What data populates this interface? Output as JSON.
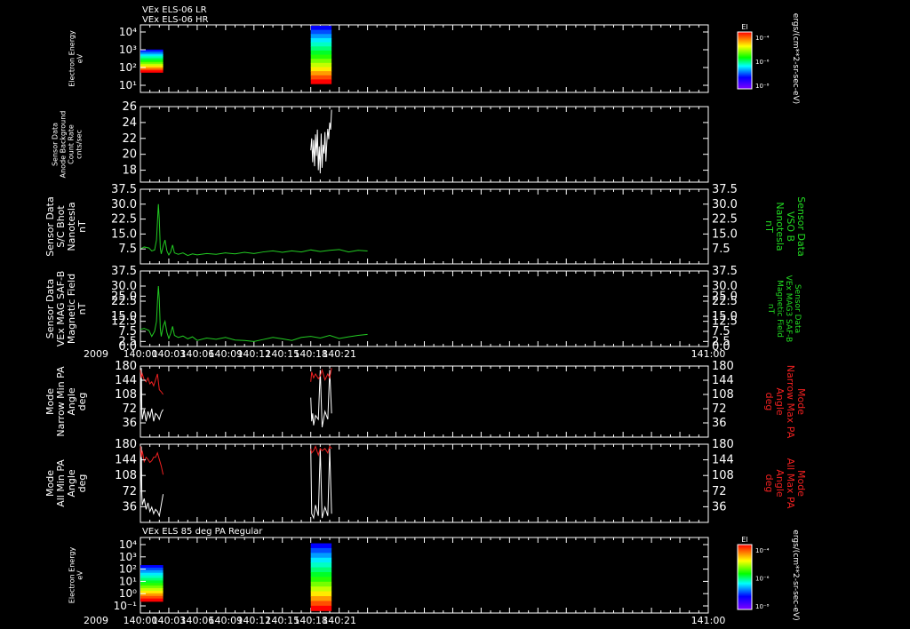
{
  "colors": {
    "background": "#000000",
    "axis": "#ffffff",
    "white_trace": "#ffffff",
    "green_trace": "#22cc22",
    "red_trace": "#ee2020",
    "green_label": "#22dd22",
    "red_label": "#ee2020"
  },
  "time_axis": {
    "year_label": "2009",
    "ticks": [
      "140:00",
      "140:03",
      "140:06",
      "140:09",
      "140:12",
      "140:15",
      "140:18",
      "140:21",
      "141:00"
    ]
  },
  "chart_data": [
    {
      "type": "heatmap",
      "title_lines": [
        "VEx ELS-06 LR",
        "VEx ELS-06 HR"
      ],
      "ylabel_lines": [
        "Electron Energy",
        "eV"
      ],
      "yticks": [
        "10⁴",
        "10³",
        "10²",
        "10¹"
      ],
      "colorbar": {
        "title": "El",
        "tick_labels": [
          "10⁻⁴",
          "10⁻⁶",
          "10⁻⁸"
        ],
        "unit": "ergs/(cm**2-sr-sec-eV)"
      },
      "blocks": [
        {
          "t_start": 0.0,
          "t_end": 2.4,
          "e_min": 0.7,
          "e_max": 2.3
        },
        {
          "t_start": 18.0,
          "t_end": 20.2,
          "e_min": 0.0,
          "e_max": 4.2
        }
      ]
    },
    {
      "type": "line",
      "ylabel_lines": [
        "Sensor Data",
        "Anode Background",
        "Count Rate",
        "cnts/sec"
      ],
      "ylim": [
        16.5,
        26
      ],
      "yticks": [
        18,
        20,
        22,
        24,
        26
      ],
      "series": [
        {
          "color_key": "white_trace",
          "x": [
            18.0,
            18.1,
            18.2,
            18.3,
            18.4,
            18.5,
            18.6,
            18.7,
            18.8,
            18.9,
            19.0,
            19.1,
            19.2,
            19.3,
            19.4,
            19.5,
            19.6,
            19.7,
            19.8,
            19.9,
            20.0,
            20.1,
            20.2
          ],
          "y": [
            20.5,
            22.0,
            19.0,
            21.8,
            18.5,
            22.5,
            19.8,
            23.1,
            18.0,
            21.0,
            17.6,
            22.6,
            18.3,
            21.2,
            20.1,
            22.8,
            19.1,
            21.5,
            23.2,
            21.9,
            24.0,
            23.1,
            25.6
          ]
        }
      ]
    },
    {
      "type": "line",
      "ylabel_lines": [
        "Sensor Data",
        "S/C Bhot",
        "Nanotesla",
        "nT"
      ],
      "right_label_lines": [
        "Sensor Data",
        "VSO B",
        "Nanotesla",
        "nT"
      ],
      "ylim": [
        0,
        37.5
      ],
      "yticks": [
        "7.5",
        "15.0",
        "22.5",
        "30.0",
        "37.5"
      ],
      "series": [
        {
          "color_key": "green_trace",
          "x": [
            0.0,
            0.4,
            0.9,
            1.2,
            1.5,
            1.7,
            1.8,
            1.9,
            2.0,
            2.1,
            2.2,
            2.4,
            2.6,
            2.8,
            3.0,
            3.2,
            3.4,
            3.6,
            4.0,
            4.5,
            5.0,
            5.5,
            6.0,
            7.0,
            8.0,
            9.0,
            10.0,
            11.0,
            12.0,
            13.0,
            14.0,
            15.0,
            16.0,
            17.0,
            18.0,
            19.0,
            20.0,
            21.0,
            22.0,
            23.0,
            24.0
          ],
          "y": [
            7.5,
            8.5,
            8.0,
            6.5,
            7.0,
            12.0,
            21.0,
            30.0,
            22.0,
            8.0,
            5.0,
            9.0,
            12.0,
            6.5,
            4.5,
            6.0,
            9.5,
            5.5,
            4.8,
            5.5,
            4.2,
            5.0,
            4.5,
            5.2,
            4.8,
            5.5,
            5.0,
            5.8,
            5.2,
            6.0,
            6.5,
            5.8,
            6.5,
            6.0,
            7.0,
            6.2,
            6.8,
            7.2,
            6.0,
            6.8,
            6.5
          ]
        }
      ]
    },
    {
      "type": "line",
      "ylabel_lines": [
        "Sensor Data",
        "VEx MAG SAF-B",
        "Magnetic Field",
        "nT"
      ],
      "right_label_lines": [
        "Sensor Data",
        "VEx MAG3 SAF-B",
        "Magnetic Field",
        "nT"
      ],
      "ylim": [
        0,
        37.5
      ],
      "yticks": [
        "0.0",
        "2.5",
        "7.5",
        "12.5",
        "15.0",
        "22.5",
        "25.0",
        "30.0",
        "37.5"
      ],
      "series": [
        {
          "color_key": "green_trace",
          "x": [
            0.0,
            0.4,
            0.9,
            1.2,
            1.5,
            1.7,
            1.8,
            1.9,
            2.0,
            2.1,
            2.2,
            2.4,
            2.6,
            2.8,
            3.0,
            3.2,
            3.4,
            3.6,
            4.0,
            4.5,
            5.0,
            5.5,
            6.0,
            7.0,
            8.0,
            9.0,
            10.0,
            11.0,
            12.0,
            13.0,
            14.0,
            15.0,
            16.0,
            17.0,
            18.0,
            19.0,
            20.0,
            21.0,
            22.0,
            23.0,
            24.0
          ],
          "y": [
            8.5,
            9.0,
            8.0,
            5.0,
            7.5,
            12.5,
            22.0,
            30.0,
            23.0,
            9.0,
            5.0,
            10.0,
            12.5,
            7.0,
            4.0,
            6.5,
            10.0,
            5.5,
            4.5,
            5.2,
            3.8,
            4.8,
            3.0,
            4.2,
            3.6,
            4.5,
            3.2,
            3.0,
            2.5,
            3.5,
            4.5,
            3.8,
            3.0,
            4.5,
            5.0,
            4.2,
            5.5,
            4.0,
            4.8,
            5.5,
            6.0
          ]
        }
      ]
    },
    {
      "type": "line",
      "ylabel_lines": [
        "Mode",
        "Narrow Min PA",
        "Angle",
        "deg"
      ],
      "right_label_lines": [
        "Mode",
        "Narrow Max PA",
        "Angle",
        "deg"
      ],
      "ylim": [
        0,
        180
      ],
      "yticks": [
        36,
        72,
        108,
        144,
        180
      ],
      "series": [
        {
          "color_key": "white_trace",
          "segments": [
            {
              "x": [
                0.0,
                0.1,
                0.15,
                0.2,
                0.4,
                0.6,
                0.8,
                1.0,
                1.2,
                1.4,
                1.6,
                1.8,
                2.0,
                2.2,
                2.4
              ],
              "y": [
                40,
                175,
                60,
                45,
                70,
                40,
                65,
                50,
                72,
                40,
                60,
                55,
                45,
                62,
                70
              ]
            },
            {
              "x": [
                18.0,
                18.1,
                18.2,
                18.3,
                18.5,
                18.8,
                19.0,
                19.2,
                19.5,
                19.8,
                20.0,
                20.2
              ],
              "y": [
                100,
                40,
                60,
                30,
                55,
                45,
                170,
                25,
                65,
                45,
                170,
                60
              ]
            }
          ]
        },
        {
          "color_key": "red_trace",
          "segments": [
            {
              "x": [
                0.0,
                0.1,
                0.2,
                0.4,
                0.6,
                0.8,
                1.0,
                1.2,
                1.4,
                1.6,
                1.8,
                2.0,
                2.2,
                2.4
              ],
              "y": [
                170,
                150,
                160,
                145,
                140,
                150,
                135,
                140,
                130,
                145,
                160,
                120,
                115,
                108
              ]
            },
            {
              "x": [
                18.0,
                18.1,
                18.3,
                18.5,
                18.8,
                19.0,
                19.2,
                19.5,
                19.8,
                20.0,
                20.2
              ],
              "y": [
                140,
                165,
                150,
                160,
                148,
                155,
                170,
                145,
                160,
                150,
                175
              ]
            }
          ]
        }
      ]
    },
    {
      "type": "line",
      "ylabel_lines": [
        "Mode",
        "All Min PA",
        "Angle",
        "deg"
      ],
      "right_label_lines": [
        "Mode",
        "All Max PA",
        "Angle",
        "deg"
      ],
      "ylim": [
        0,
        180
      ],
      "yticks": [
        36,
        72,
        108,
        144,
        180
      ],
      "series": [
        {
          "color_key": "white_trace",
          "segments": [
            {
              "x": [
                0.0,
                0.1,
                0.15,
                0.2,
                0.4,
                0.6,
                0.8,
                1.0,
                1.2,
                1.4,
                1.6,
                1.8,
                2.0,
                2.2,
                2.4
              ],
              "y": [
                50,
                175,
                65,
                40,
                55,
                30,
                45,
                25,
                35,
                20,
                30,
                25,
                15,
                40,
                65
              ]
            },
            {
              "x": [
                18.0,
                18.1,
                18.2,
                18.3,
                18.5,
                18.8,
                19.0,
                19.2,
                19.5,
                19.8,
                20.0,
                20.2
              ],
              "y": [
                170,
                20,
                15,
                10,
                40,
                15,
                170,
                10,
                35,
                15,
                170,
                20
              ]
            }
          ]
        },
        {
          "color_key": "red_trace",
          "segments": [
            {
              "x": [
                0.0,
                0.1,
                0.2,
                0.4,
                0.6,
                0.8,
                1.0,
                1.2,
                1.4,
                1.6,
                1.8,
                2.0,
                2.2,
                2.4
              ],
              "y": [
                175,
                150,
                165,
                140,
                150,
                145,
                138,
                142,
                150,
                150,
                160,
                145,
                130,
                110
              ]
            },
            {
              "x": [
                18.0,
                18.1,
                18.3,
                18.5,
                18.8,
                19.0,
                19.2,
                19.5,
                19.8,
                20.0,
                20.2
              ],
              "y": [
                170,
                160,
                165,
                175,
                155,
                170,
                165,
                170,
                160,
                175,
                170
              ]
            }
          ]
        }
      ]
    },
    {
      "type": "heatmap",
      "title_lines": [
        "VEx ELS 85 deg PA Regular"
      ],
      "ylabel_lines": [
        "Electron Energy",
        "eV"
      ],
      "yticks": [
        "10⁴",
        "10³",
        "10²",
        "10¹",
        "10⁰",
        "10⁻¹"
      ],
      "colorbar": {
        "title": "El",
        "tick_labels": [
          "10⁻⁴",
          "10⁻⁶",
          "10⁻⁸"
        ],
        "unit": "ergs/(cm**2-sr-sec-eV)"
      },
      "blocks": [
        {
          "t_start": 0.0,
          "t_end": 2.4,
          "e_min": 0.0,
          "e_max": 2.3
        },
        {
          "t_start": 18.0,
          "t_end": 20.2,
          "e_min": -0.5,
          "e_max": 3.8
        }
      ]
    }
  ]
}
